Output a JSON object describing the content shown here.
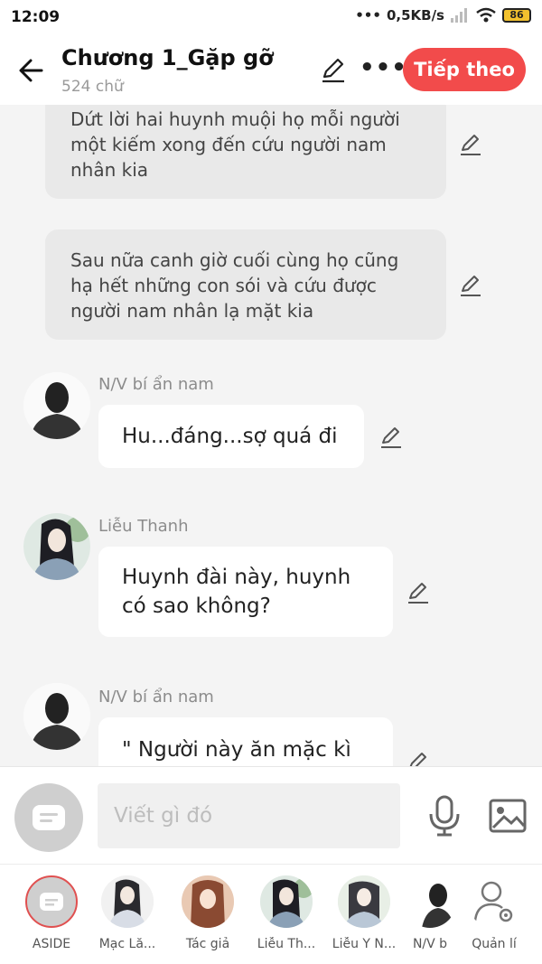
{
  "status": {
    "time": "12:09",
    "network": "0,5KB/s",
    "battery": "86"
  },
  "header": {
    "title": "Chương 1_Gặp gỡ",
    "char_count": "524 chữ",
    "next_label": "Tiếp theo",
    "more_label": "•••"
  },
  "messages": [
    {
      "type": "narration",
      "lines": [
        "Dứt lời hai huynh muội họ mỗi người",
        "một kiếm xong đến cứu người nam",
        "nhân kia"
      ]
    },
    {
      "type": "narration",
      "lines": [
        "Sau nữa canh giờ cuối cùng họ cũng",
        "hạ hết những con sói và cứu được",
        "người nam nhân lạ mặt kia"
      ]
    },
    {
      "type": "dialogue",
      "speaker": "N/V bí ẩn nam",
      "lines": [
        "Hu...đáng...sợ quá đi"
      ]
    },
    {
      "type": "dialogue",
      "speaker": "Liễu Thanh",
      "lines": [
        "Huynh đài này, huynh",
        "có sao không?"
      ]
    },
    {
      "type": "dialogue",
      "speaker": "N/V bí ẩn nam",
      "lines": [
        "\" Người này ăn mặc kì"
      ]
    }
  ],
  "composer": {
    "placeholder": "Viết gì đó"
  },
  "characters": [
    {
      "label": "ASIDE"
    },
    {
      "label": "Mạc Lă..."
    },
    {
      "label": "Tác giả"
    },
    {
      "label": "Liễu Th..."
    },
    {
      "label": "Liễu Y N..."
    },
    {
      "label": "N/V b"
    },
    {
      "label": "Quản lí"
    }
  ],
  "colors": {
    "accent": "#f24b4b",
    "narration_bg": "#e9e9e9",
    "background": "#f4f4f4"
  }
}
